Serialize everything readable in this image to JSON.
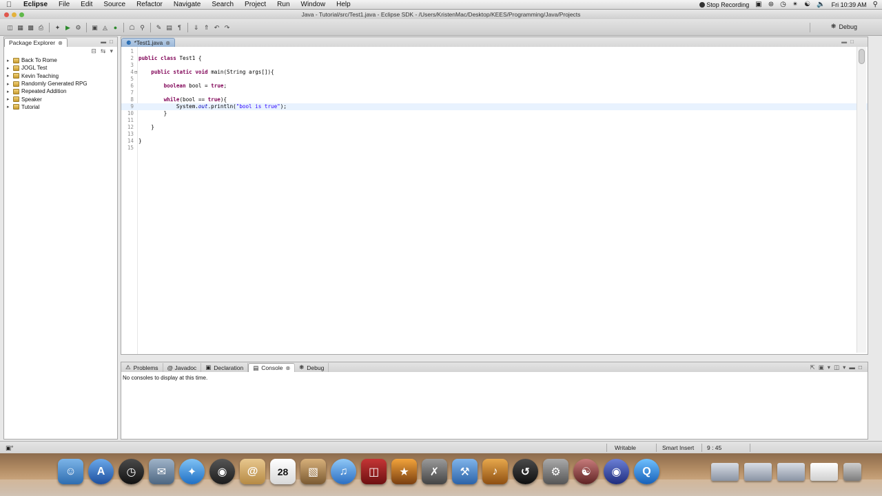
{
  "menubar": {
    "app_name": "Eclipse",
    "items": [
      "File",
      "Edit",
      "Source",
      "Refactor",
      "Navigate",
      "Search",
      "Project",
      "Run",
      "Window",
      "Help"
    ],
    "recording_label": "Stop Recording",
    "clock": "Fri 10:39 AM"
  },
  "window": {
    "title": "Java - Tutorial/src/Test1.java - Eclipse SDK - /Users/KristenMac/Desktop/KEES/Programming/Java/Projects"
  },
  "toolbar": {
    "perspective_label": "Debug"
  },
  "package_explorer": {
    "title": "Package Explorer",
    "projects": [
      "Back To Rome",
      "JOGL Test",
      "Kevin Teaching",
      "Randomly Generated RPG",
      "Repeated Addition",
      "Speaker",
      "Tutorial"
    ]
  },
  "editor": {
    "tab_label": "*Test1.java",
    "current_line": 9,
    "lines": [
      {
        "num": "1",
        "fold": "",
        "text": ""
      },
      {
        "num": "2",
        "fold": "",
        "text": "public class Test1 {"
      },
      {
        "num": "3",
        "fold": "",
        "text": ""
      },
      {
        "num": "4",
        "fold": "⊟",
        "text": "    public static void main(String args[]){"
      },
      {
        "num": "5",
        "fold": "",
        "text": ""
      },
      {
        "num": "6",
        "fold": "",
        "text": "        boolean bool = true;"
      },
      {
        "num": "7",
        "fold": "",
        "text": ""
      },
      {
        "num": "8",
        "fold": "",
        "text": "        while(bool == true){"
      },
      {
        "num": "9",
        "fold": "",
        "text": "            System.out.println(\"bool is true\");"
      },
      {
        "num": "10",
        "fold": "",
        "text": "        }"
      },
      {
        "num": "11",
        "fold": "",
        "text": ""
      },
      {
        "num": "12",
        "fold": "",
        "text": "    }"
      },
      {
        "num": "13",
        "fold": "",
        "text": ""
      },
      {
        "num": "14",
        "fold": "",
        "text": "}"
      },
      {
        "num": "15",
        "fold": "",
        "text": ""
      }
    ]
  },
  "bottom_panel": {
    "tabs": [
      {
        "label": "Problems",
        "active": false
      },
      {
        "label": "@ Javadoc",
        "active": false
      },
      {
        "label": "Declaration",
        "active": false
      },
      {
        "label": "Console",
        "active": true
      },
      {
        "label": "Debug",
        "active": false
      }
    ],
    "console_message": "No consoles to display at this time."
  },
  "statusbar": {
    "writable": "Writable",
    "insert_mode": "Smart Insert",
    "position": "9 : 45"
  },
  "dock": {
    "calendar_day": "28"
  }
}
